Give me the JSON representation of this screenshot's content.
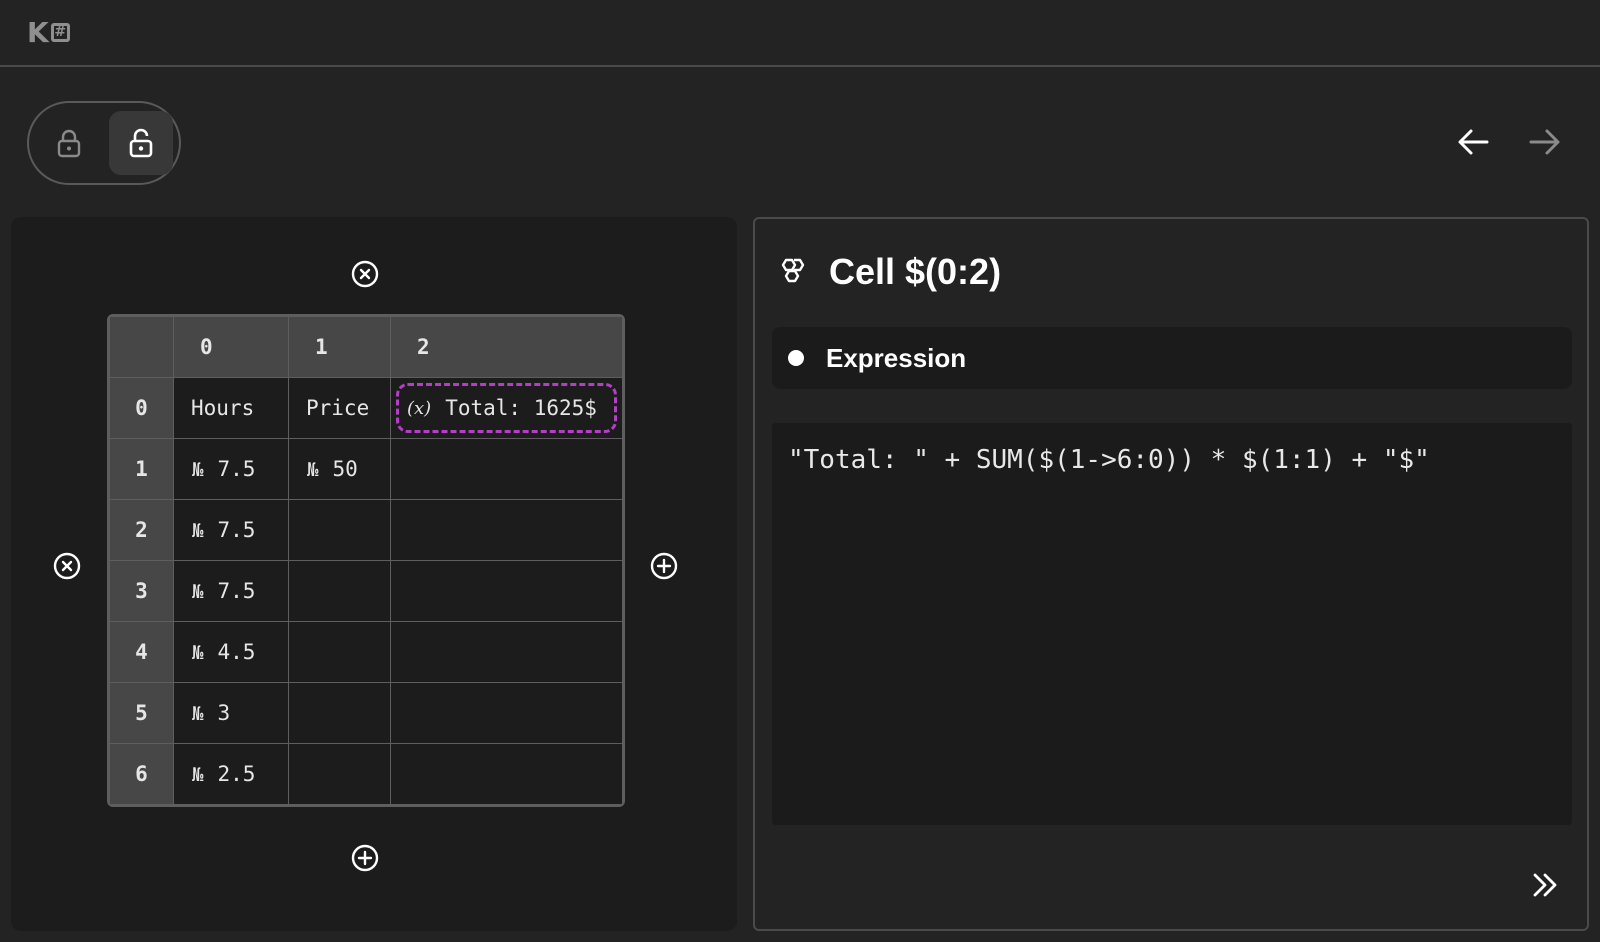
{
  "logo": {
    "text": "K",
    "mark": "#"
  },
  "toolbar": {
    "lock_icon": "lock-icon",
    "unlock_icon": "unlock-icon",
    "back_icon": "arrow-left-icon",
    "forward_icon": "arrow-right-icon"
  },
  "grid": {
    "column_headers": [
      "0",
      "1",
      "2"
    ],
    "row_headers": [
      "0",
      "1",
      "2",
      "3",
      "4",
      "5",
      "6"
    ],
    "number_prefix": "№",
    "rows": [
      {
        "c0": "Hours",
        "c1": "Price",
        "c2": "Total: 1625$"
      },
      {
        "c0": "7.5",
        "c1": "50",
        "c2": ""
      },
      {
        "c0": "7.5",
        "c1": "",
        "c2": ""
      },
      {
        "c0": "7.5",
        "c1": "",
        "c2": ""
      },
      {
        "c0": "4.5",
        "c1": "",
        "c2": ""
      },
      {
        "c0": "3",
        "c1": "",
        "c2": ""
      },
      {
        "c0": "2.5",
        "c1": "",
        "c2": ""
      }
    ],
    "selected_cell_icon": "(x)",
    "accent_color": "#b23fc4"
  },
  "inspector": {
    "title": "Cell $(0:2)",
    "type_label": "Expression",
    "expression": "\"Total: \" + SUM($(1->6:0)) * $(1:1) + \"$\""
  }
}
